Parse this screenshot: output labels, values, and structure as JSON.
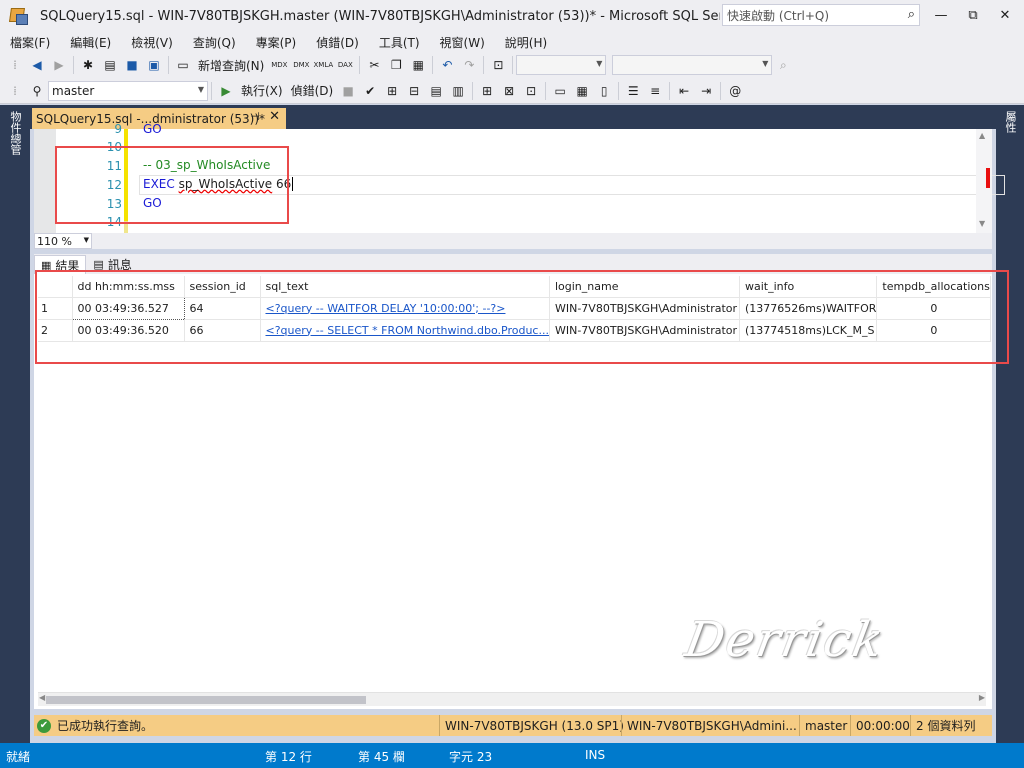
{
  "window": {
    "title": "SQLQuery15.sql - WIN-7V80TBJSKGH.master (WIN-7V80TBJSKGH\\Administrator (53))* - Microsoft SQL Server Manage...",
    "quicklaunch_placeholder": "快速啟動 (Ctrl+Q)",
    "min": "—",
    "max": "⧉",
    "close": "✕"
  },
  "menu": [
    "檔案(F)",
    "編輯(E)",
    "檢視(V)",
    "查詢(Q)",
    "專案(P)",
    "偵錯(D)",
    "工具(T)",
    "視窗(W)",
    "說明(H)"
  ],
  "toolbar1": {
    "new_query": "新增查詢(N)",
    "icons": [
      "back-icon",
      "forward-icon",
      "new-project-icon",
      "open-icon",
      "save-icon",
      "save-all-icon",
      "new-query-icon",
      "mdx-icon",
      "dmx-icon",
      "xmla-icon",
      "dax-icon",
      "cut-icon",
      "copy-icon",
      "paste-icon",
      "undo-icon",
      "redo-icon"
    ]
  },
  "toolbar2": {
    "database": "master",
    "execute": "執行(X)",
    "debug": "偵錯(D)"
  },
  "side": {
    "left": "物件總管",
    "right": "屬性"
  },
  "doc_tab": {
    "title": "SQLQuery15.sql -...dministrator (53))*",
    "pin": "⊣",
    "close": "✕"
  },
  "editor": {
    "lines": [
      {
        "num": "9",
        "text": "GO",
        "kind": "kw"
      },
      {
        "num": "10",
        "text": "",
        "kind": ""
      },
      {
        "num": "11",
        "text": "-- 03_sp_WhoIsActive",
        "kind": "cmt"
      },
      {
        "num": "12",
        "kw": "EXEC",
        "text": "sp_WhoIsActive",
        "arg": "66",
        "kind": "exec"
      },
      {
        "num": "13",
        "text": "GO",
        "kind": "kw"
      },
      {
        "num": "14",
        "text": "",
        "kind": ""
      }
    ],
    "zoom": "110 %"
  },
  "results_tabs": {
    "results": "結果",
    "messages": "訊息"
  },
  "grid": {
    "columns": [
      "dd hh:mm:ss.mss",
      "session_id",
      "sql_text",
      "login_name",
      "wait_info",
      "tempdb_allocations"
    ],
    "rows": [
      {
        "rn": "1",
        "time": "00 03:49:36.527",
        "session_id": "64",
        "sql_text": "<?query --  WAITFOR DELAY '10:00:00';  --?>",
        "login": "WIN-7V80TBJSKGH\\Administrator",
        "wait": "(13776526ms)WAITFOR",
        "tempdb": "0"
      },
      {
        "rn": "2",
        "time": "00 03:49:36.520",
        "session_id": "66",
        "sql_text": "<?query --  SELECT * FROM Northwind.dbo.Produc...",
        "login": "WIN-7V80TBJSKGH\\Administrator",
        "wait": "(13774518ms)LCK_M_S",
        "tempdb": "0"
      }
    ]
  },
  "watermark": "Derrick",
  "result_status": {
    "message": "已成功執行查詢。",
    "server": "WIN-7V80TBJSKGH (13.0 SP1)",
    "user": "WIN-7V80TBJSKGH\\Admini...",
    "db": "master",
    "elapsed": "00:00:00",
    "rows": "2 個資料列"
  },
  "statusbar": {
    "ready": "就緒",
    "line": "第 12 行",
    "col": "第 45 欄",
    "char": "字元 23",
    "ins": "INS"
  },
  "colors": {
    "accent": "#007acc",
    "tab_active": "#f5cc84",
    "dark_frame": "#2d3b55",
    "highlight_box": "#e94a4a"
  }
}
